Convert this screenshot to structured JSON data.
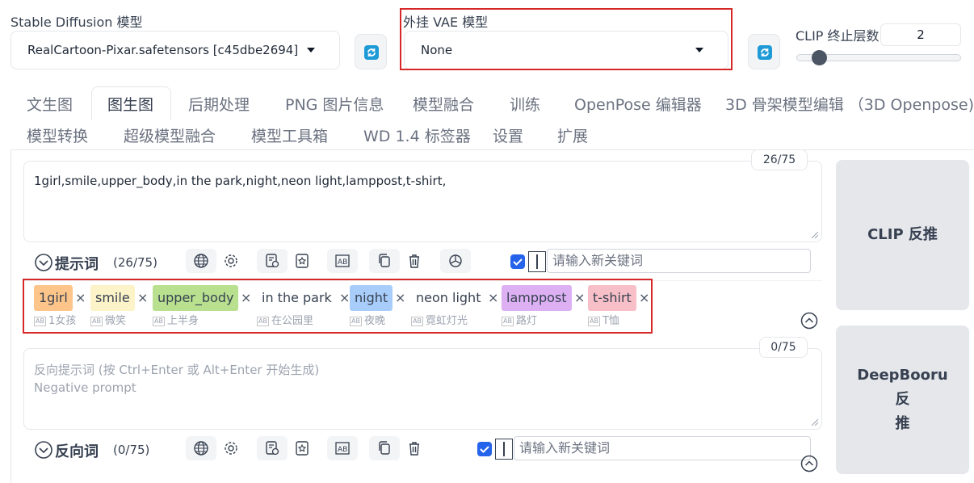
{
  "model": {
    "label": "Stable Diffusion 模型",
    "value": "RealCartoon-Pixar.safetensors [c45dbe2694]"
  },
  "vae": {
    "label": "外挂 VAE 模型",
    "value": "None"
  },
  "clip": {
    "label": "CLIP 终止层数",
    "value": "2",
    "fraction": 0.1
  },
  "tabs_row1": [
    "文生图",
    "图生图",
    "后期处理",
    "PNG 图片信息",
    "模型融合",
    "训练",
    "OpenPose 编辑器",
    "3D 骨架模型编辑 （3D Openpose)"
  ],
  "tabs_row2": [
    "模型转换",
    "超级模型融合",
    "模型工具箱",
    "WD 1.4 标签器",
    "设置",
    "扩展"
  ],
  "active_tab": "图生图",
  "prompt": {
    "counter": "26/75",
    "text": "1girl,smile,upper_body,in the park,night,neon light,lamppost,t-shirt,",
    "section_label": "提示词",
    "section_count": "(26/75)",
    "keyword_placeholder": "请输入新关键词"
  },
  "tags": [
    {
      "text": "1girl",
      "trans": "1女孩",
      "color": "#fdc58a"
    },
    {
      "text": "smile",
      "trans": "微笑",
      "color": "#fdf3c8"
    },
    {
      "text": "upper_body",
      "trans": "上半身",
      "color": "#b8e08f"
    },
    {
      "text": "in the park",
      "trans": "在公园里",
      "color": ""
    },
    {
      "text": "night",
      "trans": "夜晚",
      "color": "#a9cdfa"
    },
    {
      "text": "neon light",
      "trans": "霓虹灯光",
      "color": ""
    },
    {
      "text": "lamppost",
      "trans": "路灯",
      "color": "#dcb0f2"
    },
    {
      "text": "t-shirt",
      "trans": "T恤",
      "color": "#f7bfc8"
    }
  ],
  "negative": {
    "counter": "0/75",
    "placeholder_line1": "反向提示词 (按 Ctrl+Enter 或 Alt+Enter 开始生成)",
    "placeholder_line2": "Negative prompt",
    "section_label": "反向词",
    "section_count": "(0/75)",
    "keyword_placeholder": "请输入新关键词"
  },
  "buttons": {
    "clip_interrogate": "CLIP 反推",
    "deepbooru_line1": "DeepBooru 反",
    "deepbooru_line2": "推"
  },
  "colors": {
    "highlight_box": "#d62828",
    "refresh_icon": "#1e9bd7",
    "checkbox": "#2563eb"
  }
}
